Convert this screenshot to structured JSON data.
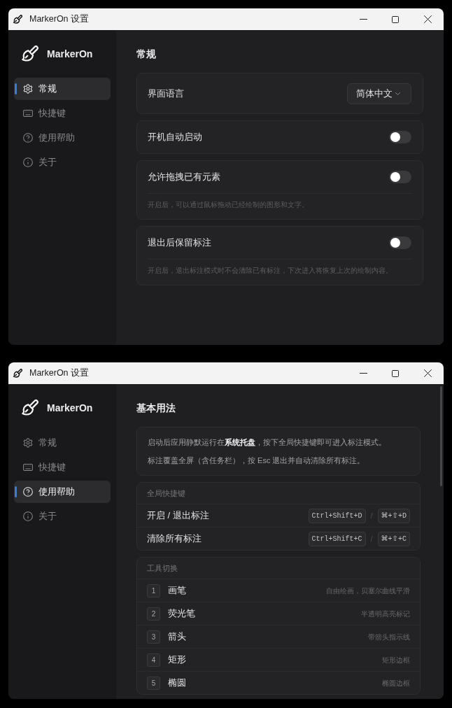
{
  "windows": [
    {
      "title": "MarkerOn 设置",
      "sidebar": {
        "app_name": "MarkerOn",
        "items": [
          {
            "label": "常规",
            "selected": true
          },
          {
            "label": "快捷键",
            "selected": false
          },
          {
            "label": "使用帮助",
            "selected": false
          },
          {
            "label": "关于",
            "selected": false
          }
        ]
      },
      "content": {
        "heading": "常规",
        "settings": [
          {
            "kind": "select",
            "label": "界面语言",
            "value": "简体中文"
          },
          {
            "kind": "toggle",
            "label": "开机自动启动",
            "on": false
          },
          {
            "kind": "toggle",
            "label": "允许拖拽已有元素",
            "on": false,
            "description": "开启后，可以通过鼠标拖动已经绘制的图形和文字。"
          },
          {
            "kind": "toggle",
            "label": "退出后保留标注",
            "on": false,
            "description": "开启后，退出标注模式时不会清除已有标注，下次进入将恢复上次的绘制内容。"
          }
        ]
      }
    },
    {
      "title": "MarkerOn 设置",
      "sidebar": {
        "app_name": "MarkerOn",
        "items": [
          {
            "label": "常规",
            "selected": false
          },
          {
            "label": "快捷键",
            "selected": false
          },
          {
            "label": "使用帮助",
            "selected": true
          },
          {
            "label": "关于",
            "selected": false
          }
        ]
      },
      "content": {
        "heading": "基本用法",
        "intro": [
          "启动后应用静默运行在**系统托盘**，按下全局快捷键即可进入标注模式。",
          "标注覆盖全屏（含任务栏），按 Esc 退出并自动清除所有标注。"
        ],
        "sections": [
          {
            "kind": "shortcuts",
            "title": "全局快捷键",
            "rows": [
              {
                "label": "开启 / 退出标注",
                "keys": [
                  "Ctrl+Shift+D",
                  "⌘+⇧+D"
                ],
                "separator": "/"
              },
              {
                "label": "清除所有标注",
                "keys": [
                  "Ctrl+Shift+C",
                  "⌘+⇧+C"
                ],
                "separator": "/"
              }
            ]
          },
          {
            "kind": "tools",
            "title": "工具切换",
            "rows": [
              {
                "number": "1",
                "label": "画笔",
                "description": "自由绘画，贝塞尔曲线平滑"
              },
              {
                "number": "2",
                "label": "荧光笔",
                "description": "半透明高亮标记"
              },
              {
                "number": "3",
                "label": "箭头",
                "description": "带箭头指示线"
              },
              {
                "number": "4",
                "label": "矩形",
                "description": "矩形边框"
              },
              {
                "number": "5",
                "label": "椭圆",
                "description": "椭圆边框"
              }
            ]
          }
        ]
      }
    }
  ]
}
